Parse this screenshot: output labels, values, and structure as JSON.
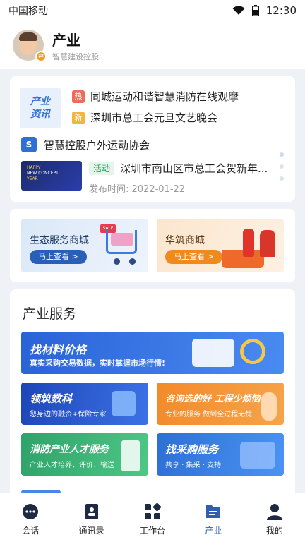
{
  "status_bar": {
    "carrier": "中国移动",
    "time": "12:30"
  },
  "header": {
    "title": "产业",
    "subtitle": "智慧建设控股"
  },
  "news": {
    "logo_line1": "产业",
    "logo_line2": "资讯",
    "headlines": [
      {
        "tag": "热",
        "text": "同城运动和谐智慧消防在线观摩"
      },
      {
        "tag": "新",
        "text": "深圳市总工会元旦文艺晚会"
      }
    ],
    "org_icon": "S",
    "org_name": "智慧控股户外运动协会",
    "thumb_line1": "HAPPY",
    "thumb_line2": "NEW CONCEPT",
    "thumb_line3": "YEAR",
    "activity_tag": "活动",
    "activity_title": "深圳市南山区市总工会贺新年...",
    "activity_date": "发布时间: 2022-01-22"
  },
  "malls": [
    {
      "name": "生态服务商城",
      "button": "马上查看 >",
      "badge": "SALE"
    },
    {
      "name": "华筑商城",
      "button": "马上查看 >"
    }
  ],
  "services": {
    "heading": "产业服务",
    "items": [
      {
        "title": "找材料价格",
        "desc": "真实采购交易数据，实时掌握市场行情!"
      },
      {
        "title": "领筑数科",
        "desc": "您身边的融资+保险专家"
      },
      {
        "title": "咨询选的好 工程少烦恼",
        "desc": "专业的服务  做到全过程无忧"
      },
      {
        "title": "消防产业人才服务",
        "desc": "产业人才培养、评价、输送"
      },
      {
        "title": "找采购服务",
        "desc": "共享 · 集采 · 支持"
      }
    ]
  },
  "tabs": [
    {
      "label": "会话",
      "icon": "chat-icon"
    },
    {
      "label": "通讯录",
      "icon": "contacts-icon"
    },
    {
      "label": "工作台",
      "icon": "workbench-icon"
    },
    {
      "label": "产业",
      "icon": "industry-icon",
      "active": true
    },
    {
      "label": "我的",
      "icon": "profile-icon"
    }
  ],
  "colors": {
    "primary": "#2f5fb4",
    "tab_active": "#2f5fb4",
    "hot_tag": "#f26a5a",
    "new_tag": "#f4b63a"
  }
}
